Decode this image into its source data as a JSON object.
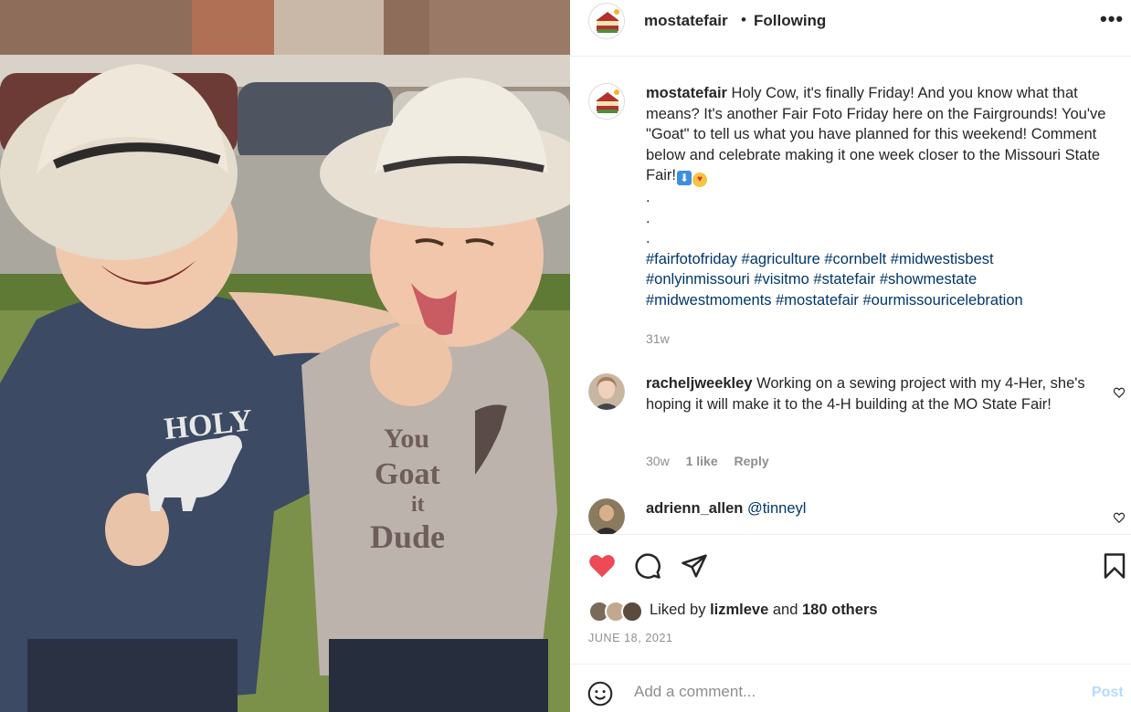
{
  "post": {
    "username": "mostatefair",
    "follow_status": "Following",
    "more_label": "•••"
  },
  "caption": {
    "username": "mostatefair",
    "text": "Holy Cow, it's finally Friday! And you know what that means? It's another Fair Foto Friday here on the Fairgrounds! You've \"Goat\" to tell us what you have planned for this weekend! Comment below and celebrate making it one week closer to the Missouri State Fair!",
    "emoji_arrow": "⬇",
    "emoji_face": "♥",
    "dots": [
      ".",
      ".",
      "."
    ],
    "hashtags_line1": "#fairfotofriday #agriculture #cornbelt #midwestisbest",
    "hashtags_line2": "#onlyinmissouri #visitmo #statefair #showmestate",
    "hashtags_line3": "#midwestmoments #mostatefair #ourmissouricelebration",
    "time": "31w"
  },
  "comments": [
    {
      "username": "racheljweekley",
      "text": "Working on a sewing project with my 4-Her, she's hoping it will make it to the 4-H building at the MO State Fair!",
      "time": "30w",
      "likes": "1 like",
      "reply_label": "Reply"
    },
    {
      "username": "adrienn_allen",
      "text": "@tinneyl"
    }
  ],
  "likes": {
    "prefix": "Liked by",
    "user": "lizmleve",
    "joiner": "and",
    "others": "180 others"
  },
  "date": "JUNE 18, 2021",
  "add_comment": {
    "placeholder": "Add a comment...",
    "post_label": "Post"
  },
  "colors": {
    "like_red": "#ed4956",
    "hashtag_blue": "#00376b",
    "meta_gray": "#8e8e8e",
    "post_disabled": "#b3dbff"
  },
  "icons": {
    "like": "heart-icon-filled",
    "comment": "comment-bubble-icon",
    "share": "paper-plane-icon",
    "save": "bookmark-icon",
    "emoji": "smiley-icon",
    "comment_like": "heart-outline-icon",
    "more": "more-options-icon"
  }
}
